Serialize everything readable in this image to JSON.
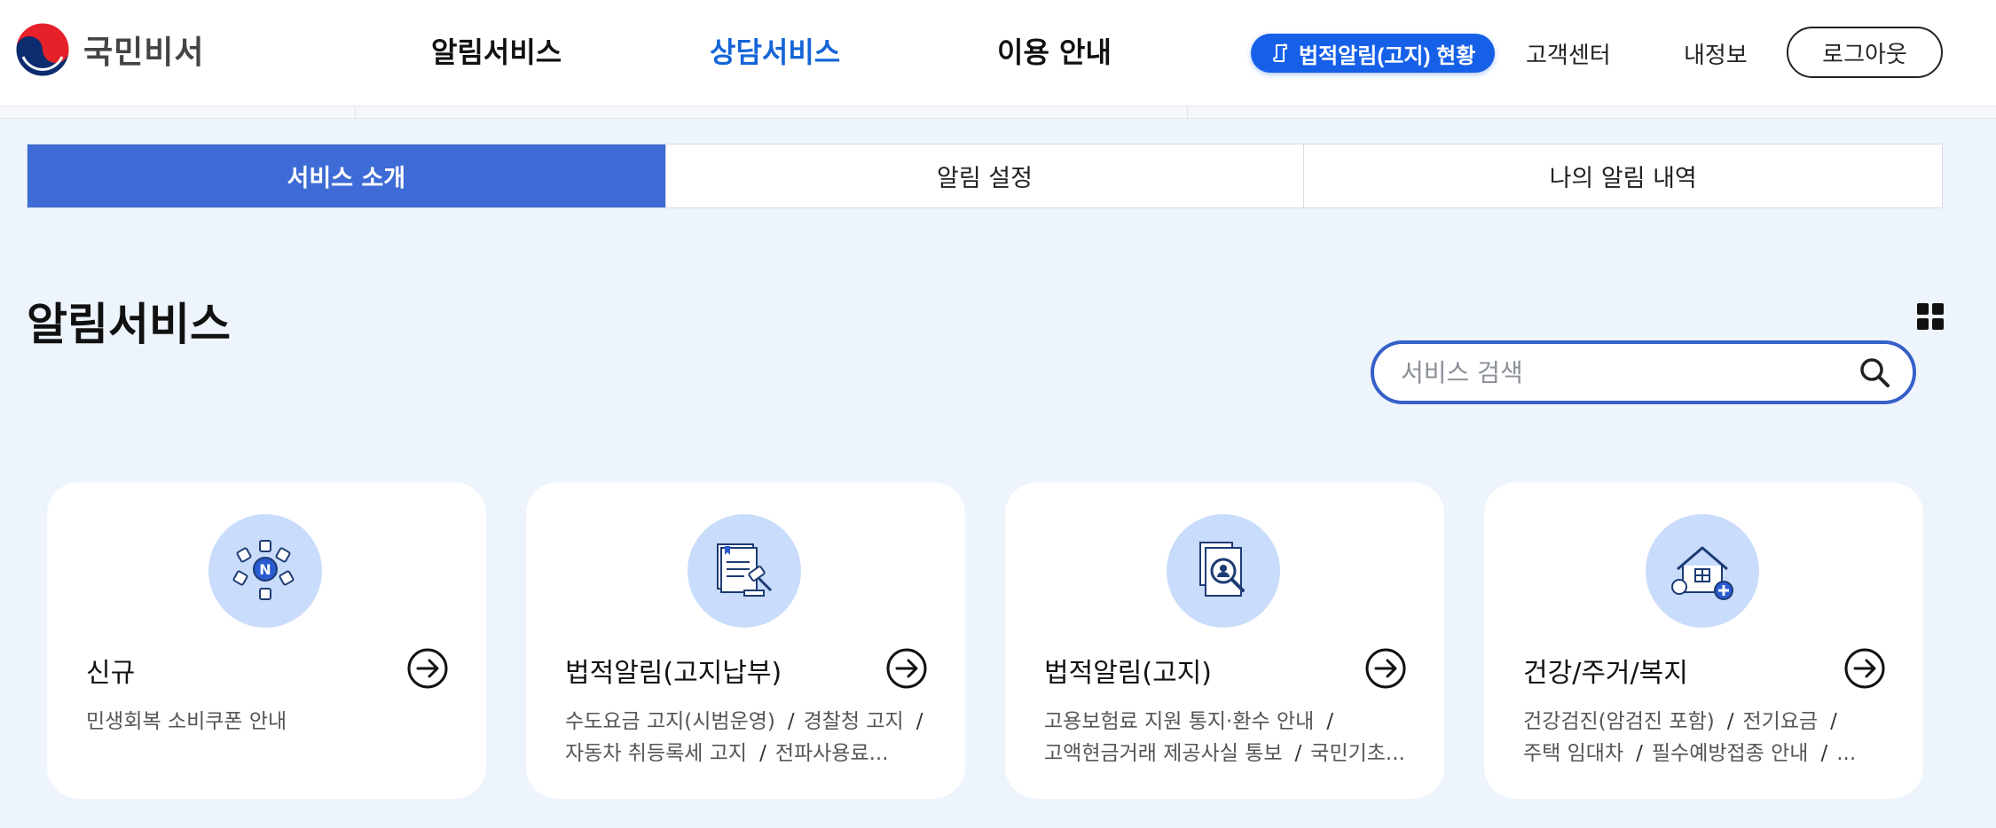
{
  "header": {
    "logo_text": "국민비서",
    "nav": [
      "알림서비스",
      "상담서비스",
      "이용 안내"
    ],
    "active_nav": 1,
    "legal_button": "법적알림(고지) 현황",
    "links": [
      "고객센터",
      "내정보"
    ],
    "logout": "로그아웃"
  },
  "tabs": [
    {
      "label": "서비스 소개",
      "active": true
    },
    {
      "label": "알림 설정",
      "active": false
    },
    {
      "label": "나의 알림 내역",
      "active": false
    }
  ],
  "page": {
    "title": "알림서비스",
    "search_placeholder": "서비스 검색"
  },
  "cards": [
    {
      "title": "신규",
      "icon": "new-service-icon",
      "items": [
        "민생회복 소비쿠폰 안내"
      ]
    },
    {
      "title": "법적알림(고지납부)",
      "icon": "legal-payment-icon",
      "items": [
        "수도요금 고지(시범운영)",
        "경찰청 고지",
        "자동차 취등록세 고지",
        "전파사용료..."
      ]
    },
    {
      "title": "법적알림(고지)",
      "icon": "legal-notice-icon",
      "items": [
        "고용보험료 지원 통지·환수 안내",
        "고액현금거래 제공사실 통보",
        "국민기초..."
      ]
    },
    {
      "title": "건강/주거/복지",
      "icon": "health-housing-icon",
      "items": [
        "건강검진(암검진 포함)",
        "전기요금",
        "주택 임대차",
        "필수예방접종 안내",
        "..."
      ]
    }
  ],
  "colors": {
    "primary": "#1565d8",
    "tab_active": "#3e6bd5",
    "background": "#eef4fc",
    "icon_circle": "#c9dcfb"
  }
}
